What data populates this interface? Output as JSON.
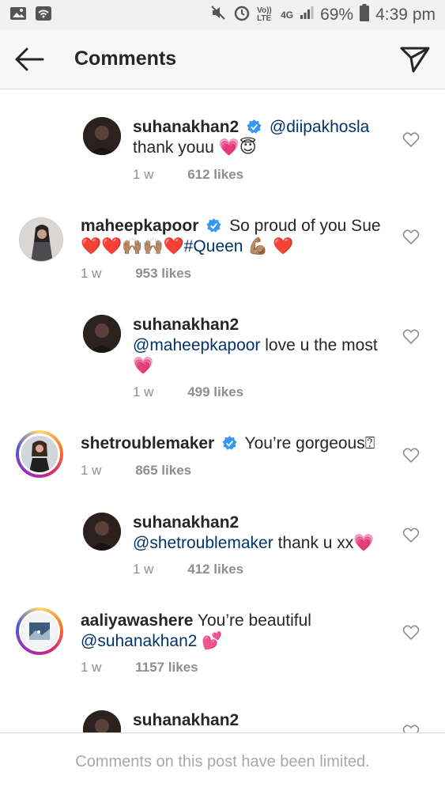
{
  "status_bar": {
    "battery": "69%",
    "time": "4:39 pm",
    "network": "4G",
    "volte": "Vo)) LTE"
  },
  "header": {
    "title": "Comments"
  },
  "comments": [
    {
      "username": "suhanakhan2",
      "verified": true,
      "mention": "@diipakhosla",
      "text_line2": "thank youu 💗😇",
      "time": "1 w",
      "likes": "612 likes",
      "reply": true
    },
    {
      "username": "maheepkapoor",
      "verified": true,
      "text": "So proud of you Sue",
      "text_line2_emoji": "❤️❤️🙌🏽🙌🏽❤️",
      "hashtag": "#Queen",
      "text_line2_end": "💪🏽 ❤️",
      "time": "1 w",
      "likes": "953 likes",
      "reply": false
    },
    {
      "username": "suhanakhan2",
      "verified": false,
      "mention": "@maheepkapoor",
      "text": "love u the most",
      "text_line3": "💗",
      "time": "1 w",
      "likes": "499 likes",
      "reply": true
    },
    {
      "username": "shetroublemaker",
      "verified": true,
      "text": "You’re gorgeous",
      "trailing_glyph": "⍰",
      "time": "1 w",
      "likes": "865 likes",
      "reply": false
    },
    {
      "username": "suhanakhan2",
      "verified": false,
      "mention": "@shetroublemaker",
      "text": "thank u xx💗",
      "time": "1 w",
      "likes": "412 likes",
      "reply": true
    },
    {
      "username": "aaliyawashere",
      "verified": false,
      "text": "You’re beautiful",
      "mention": "@suhanakhan2",
      "text_line2_end": "💕",
      "time": "1 w",
      "likes": "1157 likes",
      "reply": false
    },
    {
      "username": "suhanakhan2",
      "reply": true
    }
  ],
  "footer": {
    "notice": "Comments on this post have been limited."
  },
  "colors": {
    "mention": "#003569",
    "verified": "#3897f0",
    "meta": "#8e8e8e"
  }
}
